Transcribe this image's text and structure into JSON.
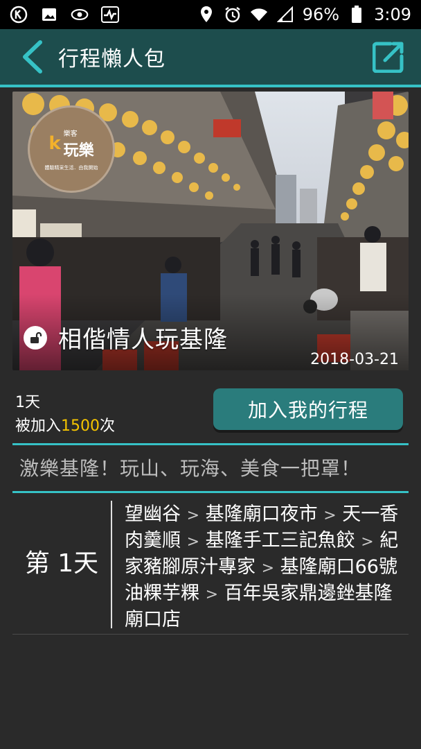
{
  "status_bar": {
    "battery": "96%",
    "time": "3:09"
  },
  "app_bar": {
    "title": "行程懶人包"
  },
  "hero": {
    "logo_mark": "k",
    "logo_sub": "樂客",
    "logo_main": "玩樂",
    "logo_slogan": "體驗精采生活．由我開始",
    "title": "相偕情人玩基隆",
    "date": "2018-03-21"
  },
  "info": {
    "days": "1天",
    "added_prefix": "被加入",
    "added_count": "1500",
    "added_suffix": "次",
    "add_button": "加入我的行程"
  },
  "slogan": "激樂基隆！玩山、玩海、美食一把罩！",
  "itinerary": {
    "day_label": "第 1天",
    "stops": [
      "望幽谷",
      "基隆廟口夜市",
      "天一香肉羹順",
      "基隆手工三記魚餃",
      "紀家豬腳原汁專家",
      "基隆廟口66號油粿芋粿",
      "百年吳家鼎邊銼基隆廟口店"
    ],
    "arrow": ">"
  },
  "colors": {
    "accent": "#36c2c6",
    "app_bar": "#1d4d4d",
    "button": "#2a7c7c",
    "highlight": "#f5c400",
    "background": "#2a2a2a"
  }
}
